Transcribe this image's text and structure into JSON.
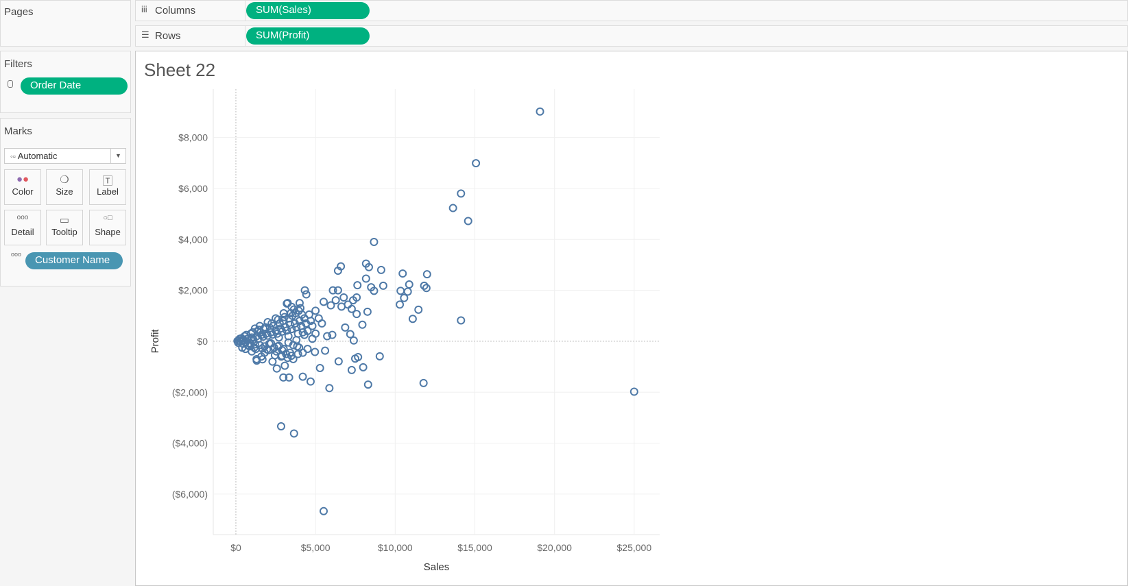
{
  "pages": {
    "title": "Pages"
  },
  "shelves": {
    "columns_label": "Columns",
    "columns_pill": "SUM(Sales)",
    "rows_label": "Rows",
    "rows_pill": "SUM(Profit)"
  },
  "filters": {
    "title": "Filters",
    "pill": "Order Date"
  },
  "marks": {
    "title": "Marks",
    "type": "Automatic",
    "buttons": [
      "Color",
      "Size",
      "Label",
      "Detail",
      "Tooltip",
      "Shape"
    ],
    "detail_pill": "Customer Name"
  },
  "sheet": {
    "title": "Sheet 22"
  },
  "colors": {
    "mark": "#4e79a7",
    "green_pill": "#00b180",
    "blue_pill": "#4996b2"
  },
  "chart_data": {
    "type": "scatter",
    "xlabel": "Sales",
    "ylabel": "Profit",
    "xlim": [
      -1420,
      26600
    ],
    "ylim": [
      -7590,
      9900
    ],
    "grid": true,
    "x_ticks": [
      0,
      5000,
      10000,
      15000,
      20000,
      25000
    ],
    "x_tick_labels": [
      "$0",
      "$5,000",
      "$10,000",
      "$15,000",
      "$20,000",
      "$25,000"
    ],
    "y_ticks": [
      8000,
      6000,
      4000,
      2000,
      0,
      -2000,
      -4000,
      -6000
    ],
    "y_tick_labels": [
      "$8,000",
      "$6,000",
      "$4,000",
      "$2,000",
      "$0",
      "($2,000)",
      "($4,000)",
      "($6,000)"
    ],
    "points": [
      [
        19090,
        9020
      ],
      [
        15070,
        6990
      ],
      [
        14130,
        5800
      ],
      [
        13630,
        5230
      ],
      [
        14580,
        4720
      ],
      [
        8670,
        3900
      ],
      [
        25000,
        -1980
      ],
      [
        14130,
        820
      ],
      [
        11780,
        -1640
      ],
      [
        8300,
        -1700
      ],
      [
        5870,
        -1840
      ],
      [
        5510,
        -6670
      ],
      [
        2840,
        -3340
      ],
      [
        3650,
        -3620
      ],
      [
        12000,
        2630
      ],
      [
        10470,
        2660
      ],
      [
        9120,
        2800
      ],
      [
        8170,
        3050
      ],
      [
        8350,
        2910
      ],
      [
        6590,
        2940
      ],
      [
        6410,
        2770
      ],
      [
        10880,
        2230
      ],
      [
        10790,
        1950
      ],
      [
        10340,
        1980
      ],
      [
        11820,
        2180
      ],
      [
        11960,
        2090
      ],
      [
        9250,
        2180
      ],
      [
        8490,
        2120
      ],
      [
        8670,
        1980
      ],
      [
        7630,
        2200
      ],
      [
        8170,
        2460
      ],
      [
        10560,
        1700
      ],
      [
        10290,
        1440
      ],
      [
        11460,
        1240
      ],
      [
        11100,
        880
      ],
      [
        9030,
        -590
      ],
      [
        7670,
        -620
      ],
      [
        7490,
        -680
      ],
      [
        7990,
        -1020
      ],
      [
        7270,
        -1130
      ],
      [
        6450,
        -790
      ],
      [
        5280,
        -1050
      ],
      [
        4690,
        -1580
      ],
      [
        4200,
        -1390
      ],
      [
        3340,
        -1420
      ],
      [
        2980,
        -1420
      ],
      [
        2570,
        -1070
      ],
      [
        3070,
        -960
      ],
      [
        5600,
        -370
      ],
      [
        7400,
        30
      ],
      [
        7180,
        280
      ],
      [
        7940,
        650
      ],
      [
        8260,
        1160
      ],
      [
        7580,
        1070
      ],
      [
        7270,
        1270
      ],
      [
        7040,
        1440
      ],
      [
        7360,
        1610
      ],
      [
        7580,
        1720
      ],
      [
        6770,
        1720
      ],
      [
        6090,
        2000
      ],
      [
        6410,
        2000
      ],
      [
        4330,
        2000
      ],
      [
        4420,
        1840
      ],
      [
        6270,
        1610
      ],
      [
        5510,
        1550
      ],
      [
        5960,
        1410
      ],
      [
        3250,
        1500
      ],
      [
        6630,
        1360
      ],
      [
        5730,
        200
      ],
      [
        6050,
        250
      ],
      [
        4960,
        -420
      ],
      [
        3970,
        -250
      ],
      [
        3480,
        -570
      ],
      [
        1670,
        -710
      ],
      [
        1310,
        -760
      ],
      [
        2890,
        -570
      ],
      [
        6860,
        540
      ],
      [
        100,
        10
      ],
      [
        200,
        30
      ],
      [
        300,
        -20
      ],
      [
        400,
        60
      ],
      [
        500,
        40
      ],
      [
        600,
        -50
      ],
      [
        700,
        90
      ],
      [
        800,
        120
      ],
      [
        900,
        -80
      ],
      [
        1000,
        150
      ],
      [
        1100,
        60
      ],
      [
        1200,
        -120
      ],
      [
        1300,
        200
      ],
      [
        1400,
        100
      ],
      [
        1500,
        -150
      ],
      [
        1600,
        250
      ],
      [
        1700,
        180
      ],
      [
        1800,
        -200
      ],
      [
        1900,
        300
      ],
      [
        2000,
        220
      ],
      [
        2100,
        -100
      ],
      [
        2200,
        350
      ],
      [
        2300,
        260
      ],
      [
        2400,
        -250
      ],
      [
        2500,
        420
      ],
      [
        2600,
        300
      ],
      [
        2700,
        -180
      ],
      [
        2800,
        500
      ],
      [
        2900,
        380
      ],
      [
        3000,
        -300
      ],
      [
        3100,
        550
      ],
      [
        3200,
        420
      ],
      [
        3300,
        200
      ],
      [
        3400,
        650
      ],
      [
        3500,
        480
      ],
      [
        3600,
        -150
      ],
      [
        3700,
        700
      ],
      [
        3800,
        550
      ],
      [
        3900,
        300
      ],
      [
        4000,
        800
      ],
      [
        4100,
        600
      ],
      [
        4200,
        350
      ],
      [
        4300,
        900
      ],
      [
        4400,
        700
      ],
      [
        150,
        -60
      ],
      [
        350,
        120
      ],
      [
        550,
        200
      ],
      [
        750,
        -150
      ],
      [
        950,
        300
      ],
      [
        1150,
        -250
      ],
      [
        1350,
        400
      ],
      [
        1550,
        350
      ],
      [
        1750,
        480
      ],
      [
        1950,
        -320
      ],
      [
        2150,
        520
      ],
      [
        2350,
        600
      ],
      [
        2550,
        -400
      ],
      [
        2750,
        700
      ],
      [
        2950,
        800
      ],
      [
        3150,
        -500
      ],
      [
        3350,
        900
      ],
      [
        3550,
        1000
      ],
      [
        3750,
        1100
      ],
      [
        3950,
        1200
      ],
      [
        4150,
        1050
      ],
      [
        250,
        100
      ],
      [
        450,
        -100
      ],
      [
        650,
        250
      ],
      [
        850,
        -200
      ],
      [
        1050,
        350
      ],
      [
        1250,
        -300
      ],
      [
        1450,
        450
      ],
      [
        1650,
        -280
      ],
      [
        1850,
        550
      ],
      [
        2050,
        -350
      ],
      [
        2250,
        700
      ],
      [
        2450,
        -550
      ],
      [
        2650,
        850
      ],
      [
        2850,
        -600
      ],
      [
        3050,
        950
      ],
      [
        3250,
        -650
      ],
      [
        3450,
        1100
      ],
      [
        3650,
        1250
      ],
      [
        3850,
        -200
      ],
      [
        4050,
        1300
      ],
      [
        1200,
        500
      ],
      [
        1500,
        600
      ],
      [
        2000,
        750
      ],
      [
        2500,
        900
      ],
      [
        3000,
        1100
      ],
      [
        3500,
        1350
      ],
      [
        4000,
        1500
      ],
      [
        3200,
        1480
      ],
      [
        2200,
        -80
      ],
      [
        2700,
        150
      ],
      [
        3300,
        -50
      ],
      [
        3800,
        50
      ],
      [
        4300,
        250
      ],
      [
        4500,
        400
      ],
      [
        4600,
        1050
      ],
      [
        4700,
        800
      ],
      [
        4800,
        600
      ],
      [
        5000,
        1200
      ],
      [
        5200,
        900
      ],
      [
        5400,
        700
      ],
      [
        5000,
        300
      ],
      [
        4800,
        100
      ],
      [
        4500,
        -300
      ],
      [
        4200,
        -450
      ],
      [
        3900,
        -500
      ],
      [
        3600,
        -700
      ],
      [
        1000,
        -400
      ],
      [
        1300,
        -700
      ],
      [
        1600,
        -600
      ],
      [
        1800,
        -450
      ],
      [
        600,
        -300
      ],
      [
        400,
        -250
      ],
      [
        2300,
        -800
      ],
      [
        2600,
        -200
      ],
      [
        2900,
        -350
      ],
      [
        3400,
        -450
      ]
    ]
  }
}
